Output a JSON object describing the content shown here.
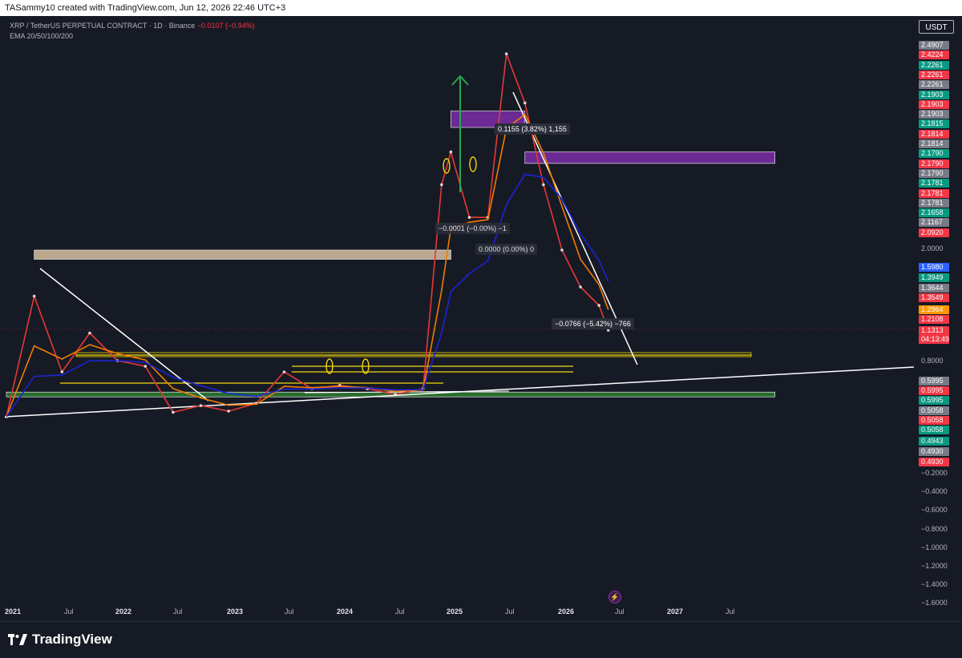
{
  "header": {
    "attribution": "TASammy10 created with TradingView.com, Jun 12, 2026 22:46 UTC+3"
  },
  "symbol": {
    "name": "XRP / TetherUS PERPETUAL CONTRACT · 1D · Binance",
    "change": "−0.0107 (−0.94%)",
    "indicator": "EMA 20/50/100/200"
  },
  "currency_button": "USDT",
  "colors": {
    "background": "#161a25",
    "ema_blue": "#1c23d6",
    "ema_orange": "#f57c00",
    "ema_red": "#e53935",
    "zone_purple": "#7b2ea8",
    "zone_tan": "#d7c1a1",
    "zone_green": "#2e7d32",
    "yellow_line": "#f5d90a",
    "up_arrow": "#26a651"
  },
  "price_tags": [
    {
      "label": "2.4907",
      "color": "#787b86"
    },
    {
      "label": "2.4224",
      "color": "#f23645"
    },
    {
      "label": "2.2261",
      "color": "#089981"
    },
    {
      "label": "2.2261",
      "color": "#f23645"
    },
    {
      "label": "2.2261",
      "color": "#787b86"
    },
    {
      "label": "2.1903",
      "color": "#089981"
    },
    {
      "label": "2.1903",
      "color": "#f23645"
    },
    {
      "label": "2.1903",
      "color": "#787b86"
    },
    {
      "label": "2.1815",
      "color": "#089981"
    },
    {
      "label": "2.1814",
      "color": "#f23645"
    },
    {
      "label": "2.1814",
      "color": "#787b86"
    },
    {
      "label": "2.1790",
      "color": "#089981"
    },
    {
      "label": "2.1790",
      "color": "#f23645"
    },
    {
      "label": "2.1790",
      "color": "#787b86"
    },
    {
      "label": "2.1781",
      "color": "#089981"
    },
    {
      "label": "2.1781",
      "color": "#f23645"
    },
    {
      "label": "2.1781",
      "color": "#787b86"
    },
    {
      "label": "2.1658",
      "color": "#089981"
    },
    {
      "label": "2.1167",
      "color": "#787b86"
    },
    {
      "label": "2.0920",
      "color": "#f23645"
    }
  ],
  "price_axis_ticks": [
    "2.0000",
    "0.8000",
    "−0.2000",
    "−0.4000",
    "−0.6000",
    "−0.8000",
    "−1.0000",
    "−1.2000",
    "−1.4000",
    "−1.6000"
  ],
  "price_tags_lower": [
    {
      "label": "1.5980",
      "color": "#2962ff"
    },
    {
      "label": "1.3949",
      "color": "#089981"
    },
    {
      "label": "1.3644",
      "color": "#787b86"
    },
    {
      "label": "1.3549",
      "color": "#f23645"
    },
    {
      "label": "1.2964",
      "color": "#ff9800"
    },
    {
      "label": "1.2108",
      "color": "#f23645"
    },
    {
      "label": "1.1313",
      "color": "#f23645"
    },
    {
      "label": "04:13:49",
      "color": "#f23645"
    }
  ],
  "price_tags_bottom": [
    {
      "label": "0.5995",
      "color": "#787b86"
    },
    {
      "label": "0.5995",
      "color": "#f23645"
    },
    {
      "label": "0.5995",
      "color": "#089981"
    },
    {
      "label": "0.5058",
      "color": "#787b86"
    },
    {
      "label": "0.5058",
      "color": "#f23645"
    },
    {
      "label": "0.5058",
      "color": "#089981"
    },
    {
      "label": "0.4943",
      "color": "#089981"
    },
    {
      "label": "0.4930",
      "color": "#787b86"
    },
    {
      "label": "0.4930",
      "color": "#f23645"
    }
  ],
  "time_axis": [
    {
      "label": "2021",
      "year": true
    },
    {
      "label": "Jul",
      "year": false
    },
    {
      "label": "2022",
      "year": true
    },
    {
      "label": "Jul",
      "year": false
    },
    {
      "label": "2023",
      "year": true
    },
    {
      "label": "Jul",
      "year": false
    },
    {
      "label": "2024",
      "year": true
    },
    {
      "label": "Jul",
      "year": false
    },
    {
      "label": "2025",
      "year": true
    },
    {
      "label": "Jul",
      "year": false
    },
    {
      "label": "2026",
      "year": true
    },
    {
      "label": "Jul",
      "year": false
    },
    {
      "label": "2027",
      "year": true
    },
    {
      "label": "Jul",
      "year": false
    }
  ],
  "measurements": {
    "top": "0.1155 (3.82%) 1,155",
    "mid1": "−0.0001 (−0.00%) −1",
    "mid2": "0.0000 (0.00%) 0",
    "recent": "−0.0766 (−5.42%) −766"
  },
  "footer_logo": "TradingView",
  "chart_data": {
    "type": "line",
    "title": "XRP / TetherUS PERPETUAL CONTRACT · 1D · Binance",
    "x": [
      "2021-01",
      "2021-04",
      "2021-07",
      "2021-10",
      "2022-01",
      "2022-04",
      "2022-07",
      "2022-10",
      "2023-01",
      "2023-04",
      "2023-07",
      "2023-10",
      "2024-01",
      "2024-04",
      "2024-07",
      "2024-10",
      "2024-12",
      "2025-01",
      "2025-03",
      "2025-05",
      "2025-07",
      "2025-09",
      "2025-11",
      "2026-01",
      "2026-03",
      "2026-05",
      "2026-06"
    ],
    "series": [
      {
        "name": "XRP",
        "values": [
          0.3,
          1.5,
          0.7,
          1.1,
          0.8,
          0.75,
          0.34,
          0.4,
          0.35,
          0.42,
          0.7,
          0.55,
          0.58,
          0.55,
          0.5,
          0.55,
          2.4,
          2.6,
          2.2,
          2.2,
          3.2,
          2.9,
          2.4,
          2.0,
          1.6,
          1.4,
          1.13
        ]
      }
    ],
    "zones": [
      {
        "kind": "purple",
        "from": 2.75,
        "to": 2.85,
        "start": "2025-01",
        "end": "2025-09"
      },
      {
        "kind": "purple",
        "from": 2.53,
        "to": 2.6,
        "start": "2025-09",
        "end": "2027-12"
      },
      {
        "kind": "tan",
        "from": 1.9,
        "to": 2.0,
        "start": "2021-04",
        "end": "2025-01"
      },
      {
        "kind": "green",
        "from": 0.48,
        "to": 0.52,
        "start": "2021-01",
        "end": "2027-12"
      }
    ],
    "ylim": [
      -1.6,
      3.5
    ],
    "grid": false
  }
}
